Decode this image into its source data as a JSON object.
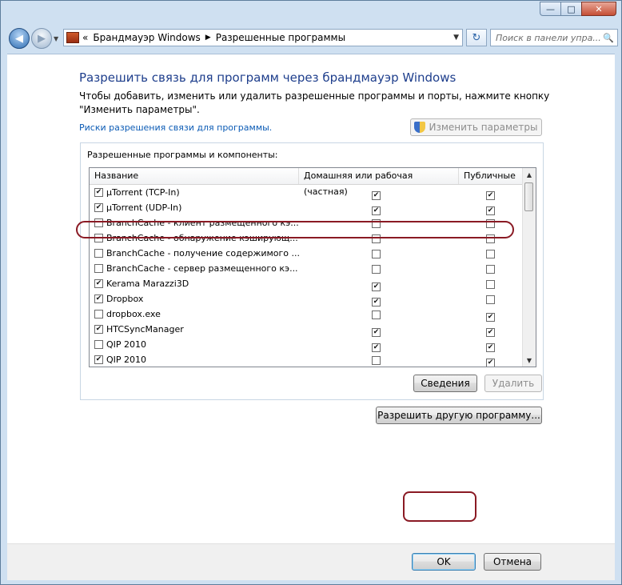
{
  "window": {
    "buttons": {
      "minimize": "—",
      "maximize": "□",
      "close": "✕"
    }
  },
  "nav": {
    "back_icon": "◀",
    "forward_icon": "▶",
    "address": {
      "prefix": "«",
      "crumbs": [
        "Брандмауэр Windows",
        "Разрешенные программы"
      ],
      "separator": "▶",
      "dropdown": "▼"
    },
    "refresh_icon": "↻",
    "search_placeholder": "Поиск в панели упра...",
    "search_icon": "🔍"
  },
  "page": {
    "heading": "Разрешить связь для программ через брандмауэр Windows",
    "description": "Чтобы добавить, изменить или удалить разрешенные программы и порты, нажмите кнопку \"Изменить параметры\".",
    "risk_link": "Риски разрешения связи для программы.",
    "change_settings_button": "Изменить параметры"
  },
  "list": {
    "group_label": "Разрешенные программы и компоненты:",
    "columns": [
      "Название",
      "Домашняя или рабочая (частная)",
      "Публичные"
    ],
    "rows": [
      {
        "name": "µTorrent (TCP-In)",
        "enabled": true,
        "home": true,
        "public": true
      },
      {
        "name": "µTorrent (UDP-In)",
        "enabled": true,
        "home": true,
        "public": true
      },
      {
        "name": "BranchCache - клиент размещенного кэ...",
        "enabled": false,
        "home": false,
        "public": false
      },
      {
        "name": "BranchCache - обнаружение кэширующ...",
        "enabled": false,
        "home": false,
        "public": false
      },
      {
        "name": "BranchCache - получение содержимого ...",
        "enabled": false,
        "home": false,
        "public": false
      },
      {
        "name": "BranchCache - сервер размещенного кэ...",
        "enabled": false,
        "home": false,
        "public": false
      },
      {
        "name": "Kerama Marazzi3D",
        "enabled": true,
        "home": true,
        "public": false
      },
      {
        "name": "Dropbox",
        "enabled": true,
        "home": true,
        "public": false
      },
      {
        "name": "dropbox.exe",
        "enabled": false,
        "home": false,
        "public": true
      },
      {
        "name": "HTCSyncManager",
        "enabled": true,
        "home": true,
        "public": true
      },
      {
        "name": "QIP 2010",
        "enabled": false,
        "home": true,
        "public": true
      },
      {
        "name": "QIP 2010",
        "enabled": true,
        "home": false,
        "public": true
      }
    ],
    "details_button": "Сведения",
    "delete_button": "Удалить"
  },
  "allow_other_button": "Разрешить другую программу...",
  "footer": {
    "ok": "OK",
    "cancel": "Отмена"
  }
}
